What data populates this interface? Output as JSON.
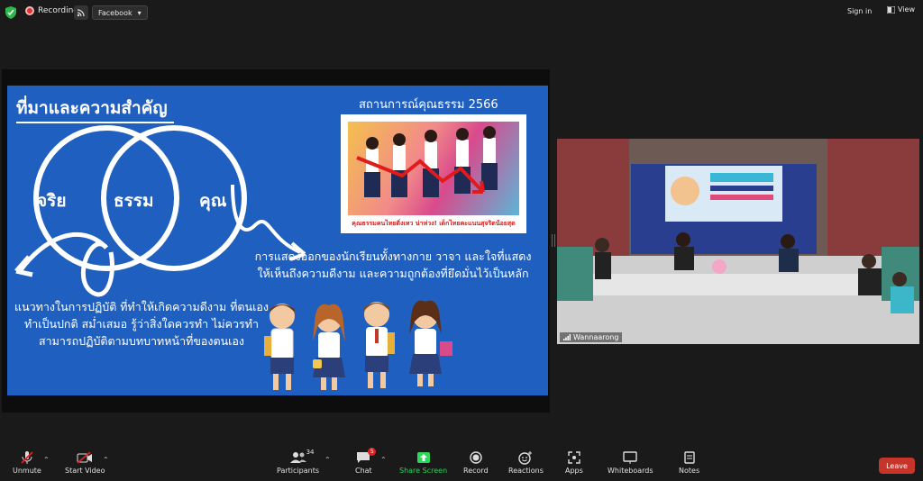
{
  "topbar": {
    "recording_label": "Recording",
    "stream_target": "Facebook",
    "sign_in": "Sign in",
    "view": "View"
  },
  "slide": {
    "title": "ที่มาและความสำคัญ",
    "circle_left": "จริย",
    "circle_center": "ธรรม",
    "circle_right": "คุณ",
    "news_title": "สถานการณ์คุณธรรม 2566",
    "news_caption": "คุณธรรมคนไทยดิ่งเหว น่าห่วง! เด็กไทยคะแนนสุจริตน้อยสุด",
    "desc_left": "แนวทางในการปฏิบัติ ที่ทำให้เกิดความดีงาม ที่ตนเองทำเป็นปกติ สม่ำเสมอ รู้ว่าสิ่งใดควรทำ ไม่ควรทำ สามารถปฏิบัติตามบทบาทหน้าที่ของตนเอง",
    "desc_right": "การแสดงออกของนักเรียนทั้งทางกาย วาจา และใจที่แสดงให้เห็นถึงความดีงาม และความถูกต้องที่ยึดมั่นไว้เป็นหลัก"
  },
  "video": {
    "participant_name": "Wannaarong"
  },
  "toolbar": {
    "unmute": "Unmute",
    "start_video": "Start Video",
    "participants": "Participants",
    "participants_count": "34",
    "chat": "Chat",
    "chat_badge": "5",
    "share_screen": "Share Screen",
    "record": "Record",
    "reactions": "Reactions",
    "apps": "Apps",
    "whiteboards": "Whiteboards",
    "notes": "Notes",
    "leave": "Leave"
  },
  "colors": {
    "slide_bg": "#1f5fbf",
    "share_green": "#2fd65c",
    "leave_red": "#c7342a",
    "record_red": "#e0312f"
  }
}
